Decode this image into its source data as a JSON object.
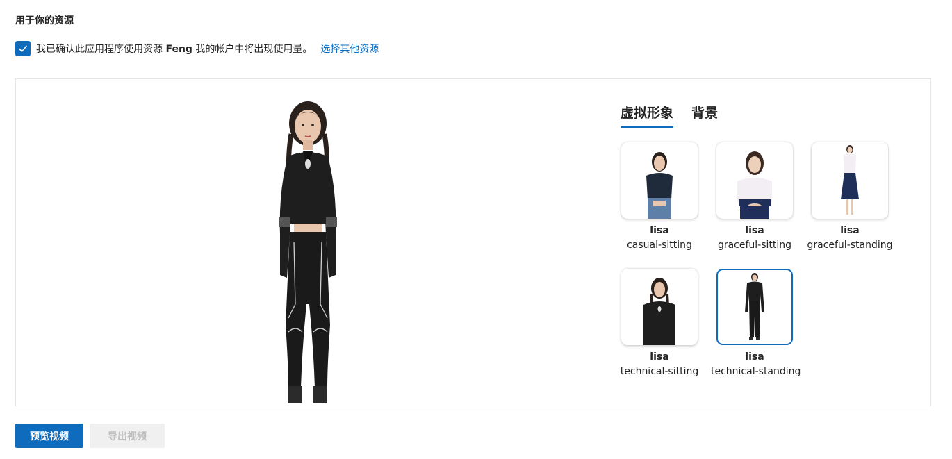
{
  "section": {
    "title": "用于你的资源"
  },
  "consent": {
    "checked": true,
    "text_before": "我已确认此应用程序使用资源 ",
    "resource_name": "Feng",
    "text_after": " 我的帐户中将出现使用量。",
    "link_label": "选择其他资源"
  },
  "tabs": [
    {
      "label": "虚拟形象",
      "active": true
    },
    {
      "label": "背景",
      "active": false
    }
  ],
  "avatars": [
    {
      "name": "lisa",
      "style": "casual-sitting",
      "selected": false
    },
    {
      "name": "lisa",
      "style": "graceful-sitting",
      "selected": false
    },
    {
      "name": "lisa",
      "style": "graceful-standing",
      "selected": false
    },
    {
      "name": "lisa",
      "style": "technical-sitting",
      "selected": false
    },
    {
      "name": "lisa",
      "style": "technical-standing",
      "selected": true
    }
  ],
  "actions": {
    "preview_label": "预览视频",
    "export_label": "导出视频"
  },
  "colors": {
    "accent": "#0f6cbd",
    "disabled_bg": "#f0f0f0",
    "disabled_text": "#bdbdbd"
  }
}
